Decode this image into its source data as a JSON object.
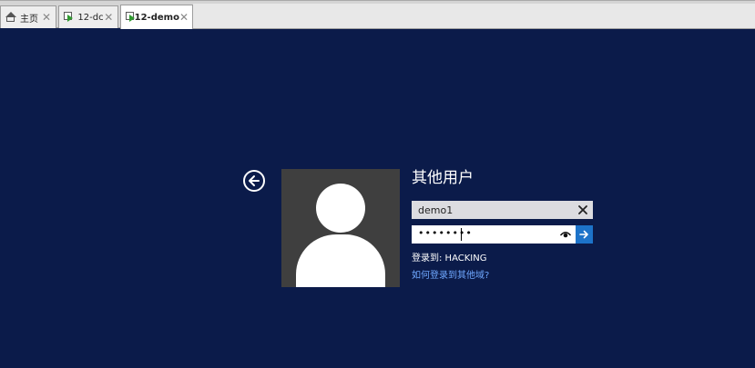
{
  "tabs": [
    {
      "label": "主页",
      "icon": "home-icon",
      "active": false
    },
    {
      "label": "12-dc",
      "icon": "vm-icon",
      "active": false
    },
    {
      "label": "12-demo",
      "icon": "vm-icon",
      "active": true
    }
  ],
  "tab_close_glyph": "✕",
  "login": {
    "title": "其他用户",
    "username_value": "demo1",
    "password_mask": "••••••••",
    "domain_text": "登录到: HACKING",
    "help_link": "如何登录到其他域?"
  },
  "colors": {
    "background": "#0b1b4a",
    "accent": "#1d73c9",
    "link": "#6fa8ff"
  }
}
